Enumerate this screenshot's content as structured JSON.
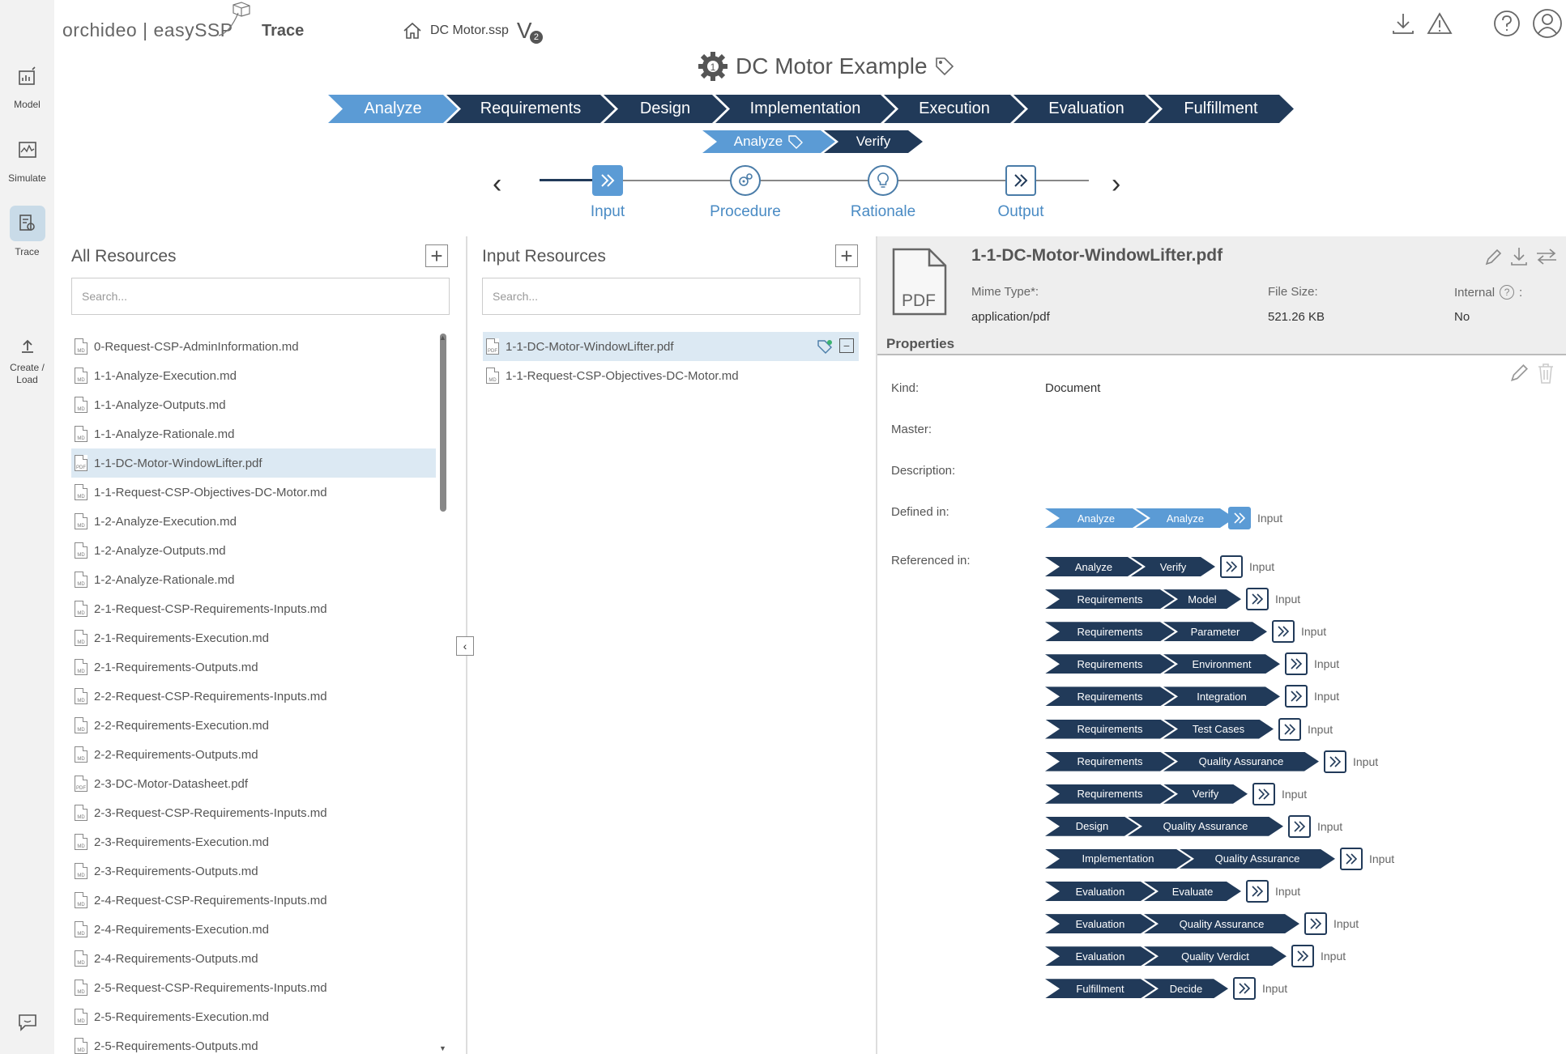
{
  "rail": {
    "items": [
      {
        "label": "Model"
      },
      {
        "label": "Simulate"
      },
      {
        "label": "Trace"
      },
      {
        "label": "Create / Load"
      }
    ]
  },
  "header": {
    "brand": "orchideo | easySSP",
    "brand_section": "Trace",
    "file_name": "DC Motor.ssp",
    "version": "V",
    "version_num": "2",
    "title": "DC Motor Example"
  },
  "phases": [
    "Analyze",
    "Requirements",
    "Design",
    "Implementation",
    "Execution",
    "Evaluation",
    "Fulfillment"
  ],
  "subphases": [
    "Analyze",
    "Verify"
  ],
  "stepper": [
    "Input",
    "Procedure",
    "Rationale",
    "Output"
  ],
  "all_resources": {
    "title": "All Resources",
    "search_placeholder": "Search...",
    "files": [
      {
        "name": "0-Request-CSP-AdminInformation.md",
        "type": "MD"
      },
      {
        "name": "1-1-Analyze-Execution.md",
        "type": "MD"
      },
      {
        "name": "1-1-Analyze-Outputs.md",
        "type": "MD"
      },
      {
        "name": "1-1-Analyze-Rationale.md",
        "type": "MD"
      },
      {
        "name": "1-1-DC-Motor-WindowLifter.pdf",
        "type": "PDF"
      },
      {
        "name": "1-1-Request-CSP-Objectives-DC-Motor.md",
        "type": "MD"
      },
      {
        "name": "1-2-Analyze-Execution.md",
        "type": "MD"
      },
      {
        "name": "1-2-Analyze-Outputs.md",
        "type": "MD"
      },
      {
        "name": "1-2-Analyze-Rationale.md",
        "type": "MD"
      },
      {
        "name": "2-1-Request-CSP-Requirements-Inputs.md",
        "type": "MD"
      },
      {
        "name": "2-1-Requirements-Execution.md",
        "type": "MD"
      },
      {
        "name": "2-1-Requirements-Outputs.md",
        "type": "MD"
      },
      {
        "name": "2-2-Request-CSP-Requirements-Inputs.md",
        "type": "MD"
      },
      {
        "name": "2-2-Requirements-Execution.md",
        "type": "MD"
      },
      {
        "name": "2-2-Requirements-Outputs.md",
        "type": "MD"
      },
      {
        "name": "2-3-DC-Motor-Datasheet.pdf",
        "type": "PDF"
      },
      {
        "name": "2-3-Request-CSP-Requirements-Inputs.md",
        "type": "MD"
      },
      {
        "name": "2-3-Requirements-Execution.md",
        "type": "MD"
      },
      {
        "name": "2-3-Requirements-Outputs.md",
        "type": "MD"
      },
      {
        "name": "2-4-Request-CSP-Requirements-Inputs.md",
        "type": "MD"
      },
      {
        "name": "2-4-Requirements-Execution.md",
        "type": "MD"
      },
      {
        "name": "2-4-Requirements-Outputs.md",
        "type": "MD"
      },
      {
        "name": "2-5-Request-CSP-Requirements-Inputs.md",
        "type": "MD"
      },
      {
        "name": "2-5-Requirements-Execution.md",
        "type": "MD"
      },
      {
        "name": "2-5-Requirements-Outputs.md",
        "type": "MD"
      }
    ]
  },
  "input_resources": {
    "title": "Input Resources",
    "search_placeholder": "Search...",
    "files": [
      {
        "name": "1-1-DC-Motor-WindowLifter.pdf",
        "type": "PDF"
      },
      {
        "name": "1-1-Request-CSP-Objectives-DC-Motor.md",
        "type": "MD"
      }
    ]
  },
  "detail": {
    "file_name": "1-1-DC-Motor-WindowLifter.pdf",
    "file_icon_text": "PDF",
    "mime_label": "Mime Type*:",
    "mime_value": "application/pdf",
    "size_label": "File Size:",
    "size_value": "521.26 KB",
    "internal_label": "Internal",
    "internal_suffix": ":",
    "internal_value": "No",
    "properties_title": "Properties",
    "kind_label": "Kind:",
    "kind_value": "Document",
    "master_label": "Master:",
    "description_label": "Description:",
    "defined_label": "Defined in:",
    "referenced_label": "Referenced in:",
    "defined_in": {
      "phase": "Analyze",
      "sub": "Analyze",
      "step": "Input"
    },
    "referenced_in": [
      {
        "phase": "Analyze",
        "sub": "Verify",
        "step": "Input"
      },
      {
        "phase": "Requirements",
        "sub": "Model",
        "step": "Input"
      },
      {
        "phase": "Requirements",
        "sub": "Parameter",
        "step": "Input"
      },
      {
        "phase": "Requirements",
        "sub": "Environment",
        "step": "Input"
      },
      {
        "phase": "Requirements",
        "sub": "Integration",
        "step": "Input"
      },
      {
        "phase": "Requirements",
        "sub": "Test Cases",
        "step": "Input"
      },
      {
        "phase": "Requirements",
        "sub": "Quality Assurance",
        "step": "Input"
      },
      {
        "phase": "Requirements",
        "sub": "Verify",
        "step": "Input"
      },
      {
        "phase": "Design",
        "sub": "Quality Assurance",
        "step": "Input"
      },
      {
        "phase": "Implementation",
        "sub": "Quality Assurance",
        "step": "Input"
      },
      {
        "phase": "Evaluation",
        "sub": "Evaluate",
        "step": "Input"
      },
      {
        "phase": "Evaluation",
        "sub": "Quality Assurance",
        "step": "Input"
      },
      {
        "phase": "Evaluation",
        "sub": "Quality Verdict",
        "step": "Input"
      },
      {
        "phase": "Fulfillment",
        "sub": "Decide",
        "step": "Input"
      }
    ]
  },
  "colors": {
    "accent": "#5b9bd5",
    "dark": "#213a59",
    "selected_row": "#dce9f3"
  }
}
